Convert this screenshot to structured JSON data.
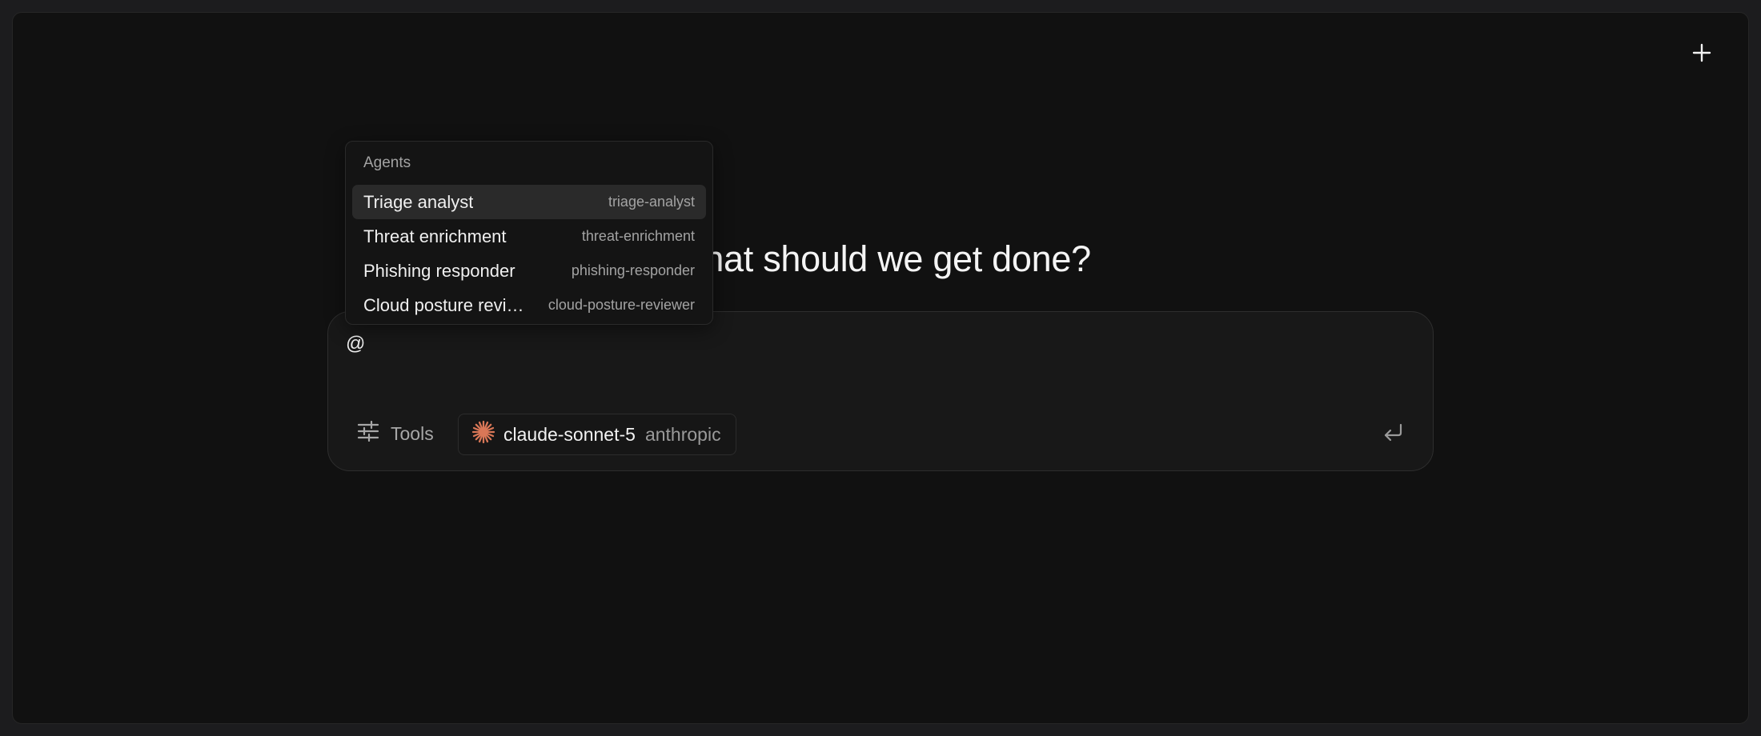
{
  "header": {
    "new_icon": "plus-icon"
  },
  "main": {
    "heading": "What should we get done?"
  },
  "composer": {
    "input_value": "@",
    "tools_label": "Tools",
    "tools_icon": "sliders-icon",
    "model": {
      "name": "claude-sonnet-5",
      "provider": "anthropic",
      "icon": "anthropic-logo-icon",
      "icon_color": "#d97757"
    },
    "send_icon": "enter-return-icon"
  },
  "agent_menu": {
    "heading": "Agents",
    "items": [
      {
        "label": "Triage analyst",
        "slug": "triage-analyst",
        "active": true
      },
      {
        "label": "Threat enrichment",
        "slug": "threat-enrichment",
        "active": false
      },
      {
        "label": "Phishing responder",
        "slug": "phishing-responder",
        "active": false
      },
      {
        "label": "Cloud posture reviewer",
        "slug": "cloud-posture-reviewer",
        "active": false
      }
    ]
  },
  "colors": {
    "background": "#111111",
    "menu_active": "#2a2a2a",
    "accent_model": "#d97757"
  }
}
